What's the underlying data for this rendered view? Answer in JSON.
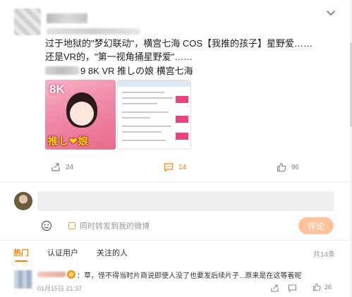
{
  "post": {
    "text_lines": [
      "过于地狱的\"梦幻联动\"，横宫七海 COS【我推的孩子】星野爱……",
      "还是VR的，\"第一视角捅星野爱\"……"
    ],
    "reference_line": "9 8K VR 推しの娘 横宫七海",
    "cover": {
      "badge": "8K",
      "title": "推し❤娘"
    }
  },
  "actions": {
    "repost_count": "24",
    "comment_count": "14",
    "like_count": "96"
  },
  "composer": {
    "input_placeholder": "",
    "repost_label": "同时转发到我的微博",
    "submit_label": "评论"
  },
  "comments_section": {
    "tabs": [
      {
        "label": "热门",
        "active": true
      },
      {
        "label": "认证用户",
        "active": false
      },
      {
        "label": "关注的人",
        "active": false
      }
    ],
    "total_label": "共14条",
    "items": [
      {
        "text": "：草，怪不得当时片商说即使人没了也要发后续片子...原来是在这等着呢",
        "time": "01月15日 21:37",
        "like_count": "26"
      }
    ]
  },
  "colors": {
    "accent": "#ff8200",
    "submit_disabled": "#ffc49b",
    "muted_text": "#999999"
  },
  "icons": [
    "chevron-down-icon",
    "repost-icon",
    "comment-icon",
    "like-icon",
    "emoji-icon",
    "share-icon",
    "reply-icon"
  ]
}
